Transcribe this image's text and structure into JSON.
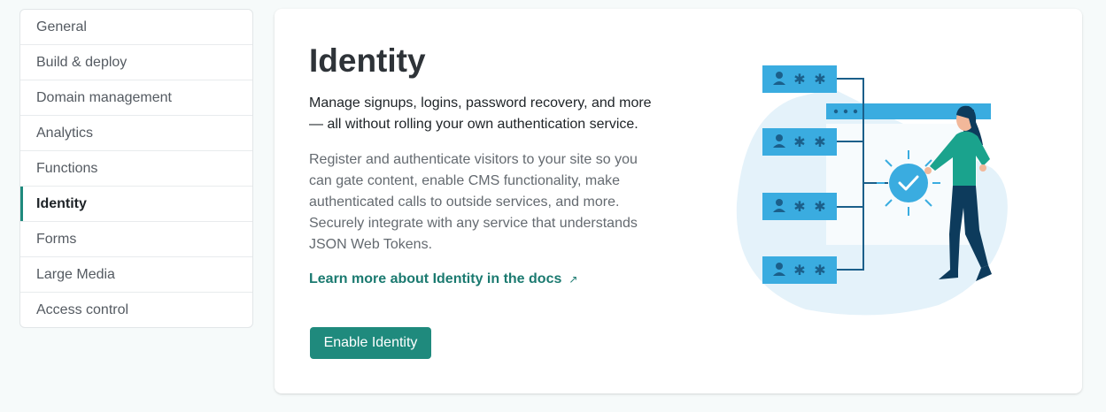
{
  "sidebar": {
    "items": [
      {
        "label": "General"
      },
      {
        "label": "Build & deploy"
      },
      {
        "label": "Domain management"
      },
      {
        "label": "Analytics"
      },
      {
        "label": "Functions"
      },
      {
        "label": "Identity",
        "active": true
      },
      {
        "label": "Forms"
      },
      {
        "label": "Large Media"
      },
      {
        "label": "Access control"
      }
    ]
  },
  "main": {
    "title": "Identity",
    "lead": "Manage signups, logins, password recovery, and more — all without rolling your own authentication service.",
    "description": "Register and authenticate visitors to your site so you can gate content, enable CMS functionality, make authenticated calls to outside services, and more. Securely integrate with any service that understands JSON Web Tokens.",
    "docs_link": "Learn more about Identity in the docs",
    "docs_link_icon": "external-arrow-icon",
    "enable_button": "Enable Identity"
  },
  "colors": {
    "accent": "#1f8a7d",
    "illustration_blue": "#3aace0",
    "illustration_dark": "#1b5f8a"
  }
}
